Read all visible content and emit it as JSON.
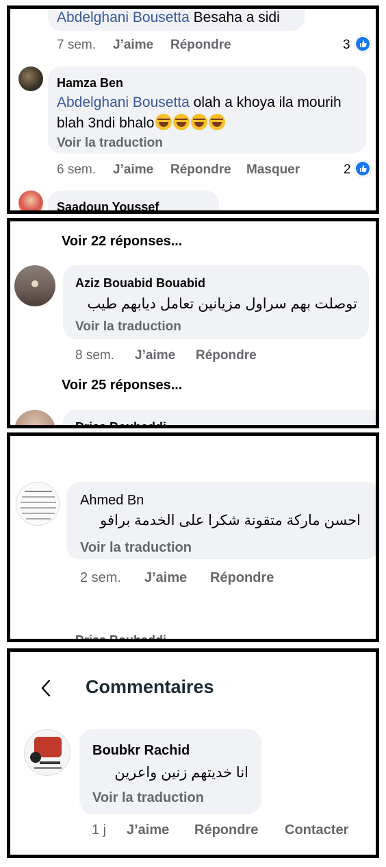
{
  "panel1": {
    "partial_comment": {
      "mention": "Abdelghani Bousetta",
      "text": "Besaha a sidi",
      "time": "7 sem.",
      "like": "J’aime",
      "reply": "Répondre",
      "reaction_count": "3"
    },
    "comment": {
      "name": "Hamza Ben",
      "mention": "Abdelghani Bousetta",
      "text_line1": "olah a khoya ila mourih",
      "text_line2": "blah 3ndi bhalo",
      "emojis": [
        "rofl-emoji",
        "rofl-emoji",
        "rofl-emoji",
        "rofl-emoji"
      ],
      "translate": "Voir la traduction",
      "time": "6 sem.",
      "like": "J’aime",
      "reply": "Répondre",
      "hide": "Masquer",
      "reaction_count": "2"
    },
    "next_name": "Saadoun Youssef"
  },
  "panel2": {
    "see_replies_1": "Voir 22 réponses...",
    "comment": {
      "name": "Aziz Bouabid Bouabid",
      "text": "توصلت بهم سراول مزيانين تعامل ديابهم طيب",
      "translate": "Voir la traduction",
      "time": "8 sem.",
      "like": "J’aime",
      "reply": "Répondre"
    },
    "see_replies_2": "Voir 25 réponses...",
    "next_name": "Driss Bouhaddi"
  },
  "panel3": {
    "comment": {
      "name": "Ahmed Bn",
      "text": "احسن ماركة متقونة شكرا على الخدمة برافو",
      "translate": "Voir la traduction",
      "time": "2 sem.",
      "like": "J’aime",
      "reply": "Répondre"
    },
    "next_name": "Driss Bouhaddi"
  },
  "panel4": {
    "header_title": "Commentaires",
    "comment": {
      "name": "Boubkr Rachid",
      "text": "انا خديتهم زنين واعرين",
      "translate": "Voir la traduction",
      "time": "1 j",
      "like": "J’aime",
      "reply": "Répondre",
      "contact": "Contacter"
    }
  },
  "colors": {
    "bubble": "#f0f2f5",
    "secondary_text": "#65676b",
    "mention": "#385898",
    "like_blue": "#1877f2"
  }
}
